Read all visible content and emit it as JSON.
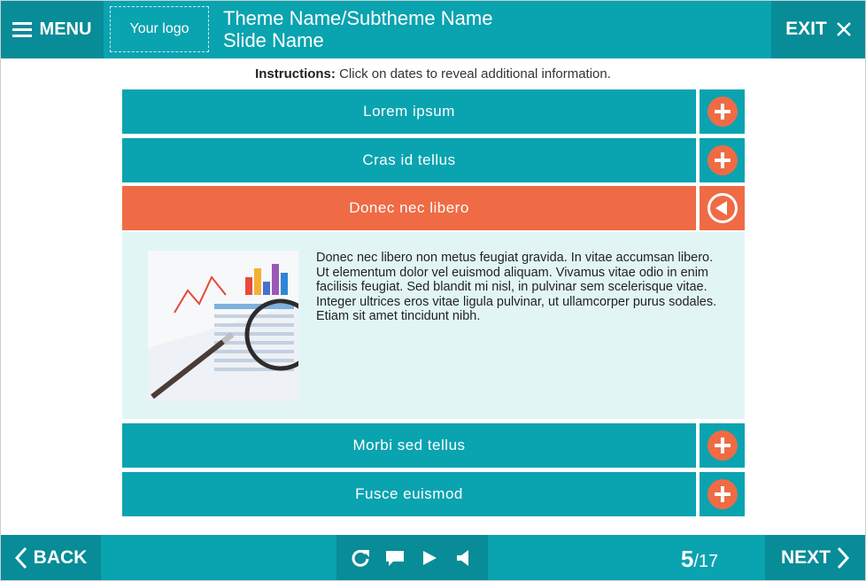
{
  "header": {
    "menu_label": "MENU",
    "logo_text": "Your logo",
    "theme_title": "Theme Name/Subtheme Name",
    "slide_title": "Slide Name",
    "exit_label": "EXIT"
  },
  "instructions": {
    "bold": "Instructions:",
    "text": " Click on dates to reveal additional information."
  },
  "accordion": {
    "items": [
      {
        "label": "Lorem ipsum"
      },
      {
        "label": "Cras id tellus"
      },
      {
        "label": "Donec nec libero"
      },
      {
        "label": "Morbi sed tellus"
      },
      {
        "label": "Fusce euismod"
      }
    ],
    "active_index": 2,
    "panel_text": "Donec nec libero non metus feugiat gravida. In vitae accumsan libero. Ut elementum dolor vel euismod aliquam. Vivamus vitae odio in enim facilisis feugiat. Sed blandit mi nisl, in pulvinar sem scelerisque vitae. Integer ultrices eros vitae ligula pulvinar, ut ullamcorper purus sodales. Etiam sit amet tincidunt nibh."
  },
  "footer": {
    "back_label": "BACK",
    "next_label": "NEXT",
    "current_page": "5",
    "total_pages": "/17"
  },
  "colors": {
    "teal": "#0aa3b0",
    "teal_dark": "#088c97",
    "accent": "#ef6b45",
    "panel_bg": "#e2f5f5"
  },
  "icons": [
    "hamburger-icon",
    "close-icon",
    "plus-icon",
    "collapse-arrow-icon",
    "chevron-left-icon",
    "replay-icon",
    "comment-icon",
    "play-icon",
    "volume-icon",
    "chevron-right-icon"
  ]
}
